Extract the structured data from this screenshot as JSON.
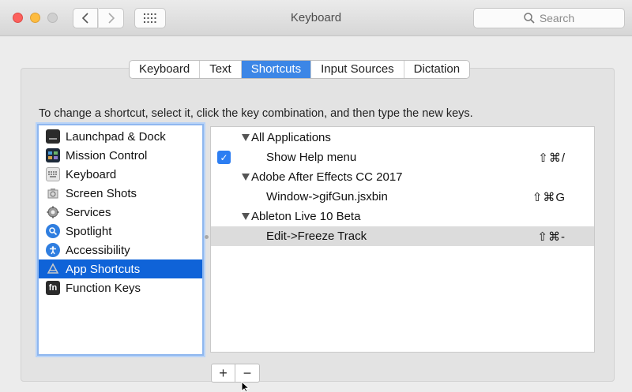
{
  "window": {
    "title": "Keyboard"
  },
  "search": {
    "placeholder": "Search"
  },
  "tabs": [
    {
      "label": "Keyboard"
    },
    {
      "label": "Text"
    },
    {
      "label": "Shortcuts",
      "active": true
    },
    {
      "label": "Input Sources"
    },
    {
      "label": "Dictation"
    }
  ],
  "instruction": "To change a shortcut, select it, click the key combination, and then type the new keys.",
  "categories": [
    {
      "label": "Launchpad & Dock",
      "icon": "launchpad-icon"
    },
    {
      "label": "Mission Control",
      "icon": "mission-control-icon"
    },
    {
      "label": "Keyboard",
      "icon": "keyboard-icon"
    },
    {
      "label": "Screen Shots",
      "icon": "screenshot-icon"
    },
    {
      "label": "Services",
      "icon": "gear-icon"
    },
    {
      "label": "Spotlight",
      "icon": "spotlight-icon"
    },
    {
      "label": "Accessibility",
      "icon": "accessibility-icon"
    },
    {
      "label": "App Shortcuts",
      "icon": "app-store-icon",
      "selected": true
    },
    {
      "label": "Function Keys",
      "icon": "fn-icon",
      "icon_text": "fn"
    }
  ],
  "shortcuts": {
    "groups": [
      {
        "label": "All Applications"
      },
      {
        "label": "Adobe After Effects CC 2017"
      },
      {
        "label": "Ableton Live 10 Beta"
      }
    ],
    "items": [
      {
        "label": "Show Help menu",
        "keys": "⇧⌘/",
        "checked": true
      },
      {
        "label": "Window->gifGun.jsxbin",
        "keys": "⇧⌘G"
      },
      {
        "label": "Edit->Freeze Track",
        "keys": "⇧⌘-",
        "selected": true
      }
    ]
  },
  "buttons": {
    "add": "+",
    "remove": "−"
  },
  "colors": {
    "accent": "#0f63d8",
    "tab_active": "#3c86e6"
  }
}
